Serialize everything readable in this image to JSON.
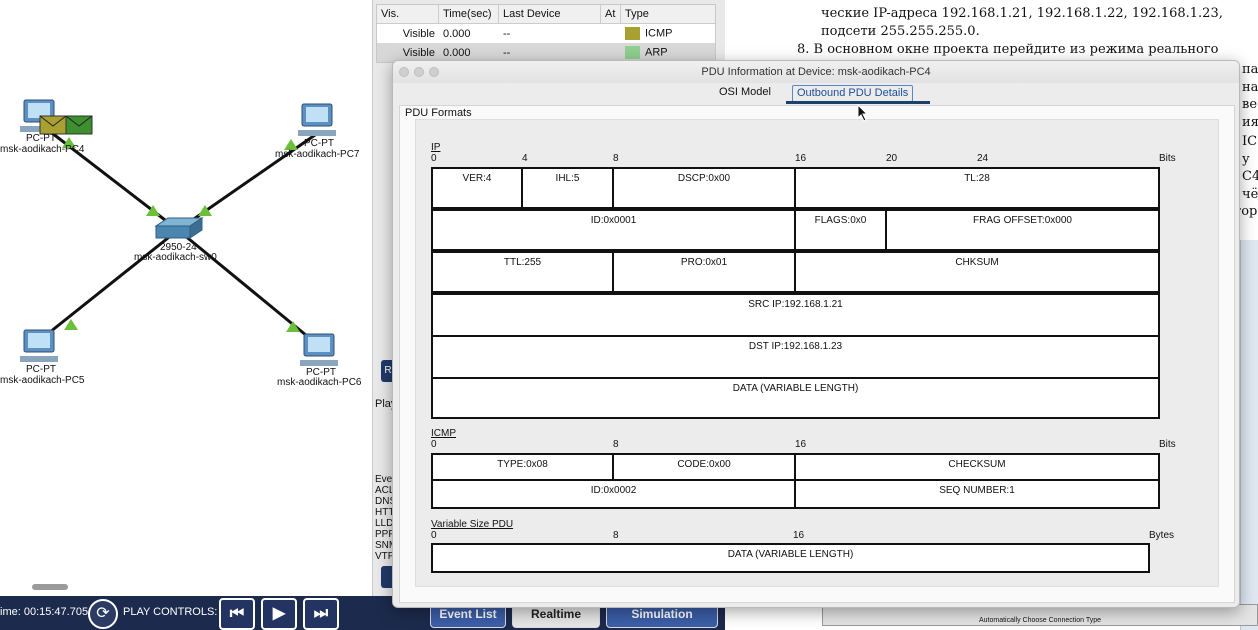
{
  "topology": {
    "devices": [
      {
        "id": "pc4",
        "type_label": "PC-PT",
        "name": "msk-aodikach-PC4"
      },
      {
        "id": "pc7",
        "type_label": "PC-PT",
        "name": "msk-aodikach-PC7"
      },
      {
        "id": "sw0",
        "type_label": "2950-24",
        "name": "msk-aodikach-sw0"
      },
      {
        "id": "pc5",
        "type_label": "PC-PT",
        "name": "msk-aodikach-PC5"
      },
      {
        "id": "pc6",
        "type_label": "PC-PT",
        "name": "msk-aodikach-PC6"
      }
    ],
    "link_status_color": "#6cbf3b",
    "pdu_envelope_color": "#3e8f2f"
  },
  "bottom_bar": {
    "time_text": "ime: 00:15:47.705",
    "play_controls_label": "PLAY CONTROLS:",
    "event_list_label": "Event List",
    "realtime_label": "Realtime",
    "simulation_label": "Simulation"
  },
  "event_list": {
    "columns": [
      "Vis.",
      "Time(sec)",
      "Last Device",
      "At",
      "Type"
    ],
    "rows": [
      {
        "vis": "Visible",
        "time": "0.000",
        "last_device": "--",
        "at": "",
        "type": "ICMP",
        "color": "#a8a030"
      },
      {
        "vis": "Visible",
        "time": "0.000",
        "last_device": "--",
        "at": "",
        "type": "ARP",
        "color": "#8fcf8f"
      }
    ],
    "side_play_text": "Play",
    "side_button_text": "R",
    "filter_snippets": [
      "Eve",
      "ACL",
      "DNS",
      "HTT",
      "LLD",
      "PPP",
      "SNM",
      "VTP"
    ]
  },
  "document": {
    "lines": [
      "ческие IP-адреса 192.168.1.21, 192.168.1.22, 192.168.1.23,",
      "подсети 255.255.255.0.",
      "8.  В основном окне проекта перейдите из режима реального"
    ],
    "right_fragments": [
      "па",
      "на",
      "ве",
      "ия",
      "IC",
      "у",
      "С4",
      "чё",
      "тор"
    ],
    "mini_bar_text": "Automatically Choose Connection Type"
  },
  "dialog": {
    "title": "PDU Information at Device: msk-aodikach-PC4",
    "tabs": [
      {
        "label": "OSI Model",
        "active": false
      },
      {
        "label": "Outbound PDU Details",
        "active": true
      }
    ],
    "formats_label": "PDU Formats",
    "ip": {
      "label": "IP",
      "ticks": [
        "0",
        "4",
        "8",
        "16",
        "20",
        "24"
      ],
      "units": "Bits",
      "rows": [
        [
          "VER:4",
          "IHL:5",
          "DSCP:0x00",
          "TL:28"
        ],
        [
          "ID:0x0001",
          "FLAGS:0x0",
          "FRAG OFFSET:0x000"
        ],
        [
          "TTL:255",
          "PRO:0x01",
          "CHKSUM"
        ],
        [
          "SRC IP:192.168.1.21"
        ],
        [
          "DST IP:192.168.1.23"
        ],
        [
          "DATA (VARIABLE LENGTH)"
        ]
      ]
    },
    "icmp": {
      "label": "ICMP",
      "ticks": [
        "0",
        "8",
        "16"
      ],
      "units": "Bits",
      "rows": [
        [
          "TYPE:0x08",
          "CODE:0x00",
          "CHECKSUM"
        ],
        [
          "ID:0x0002",
          "SEQ NUMBER:1"
        ]
      ]
    },
    "var_pdu": {
      "label": "Variable Size PDU",
      "ticks": [
        "0",
        "8",
        "16"
      ],
      "units": "Bytes",
      "rows": [
        [
          "DATA (VARIABLE LENGTH)"
        ]
      ]
    }
  }
}
